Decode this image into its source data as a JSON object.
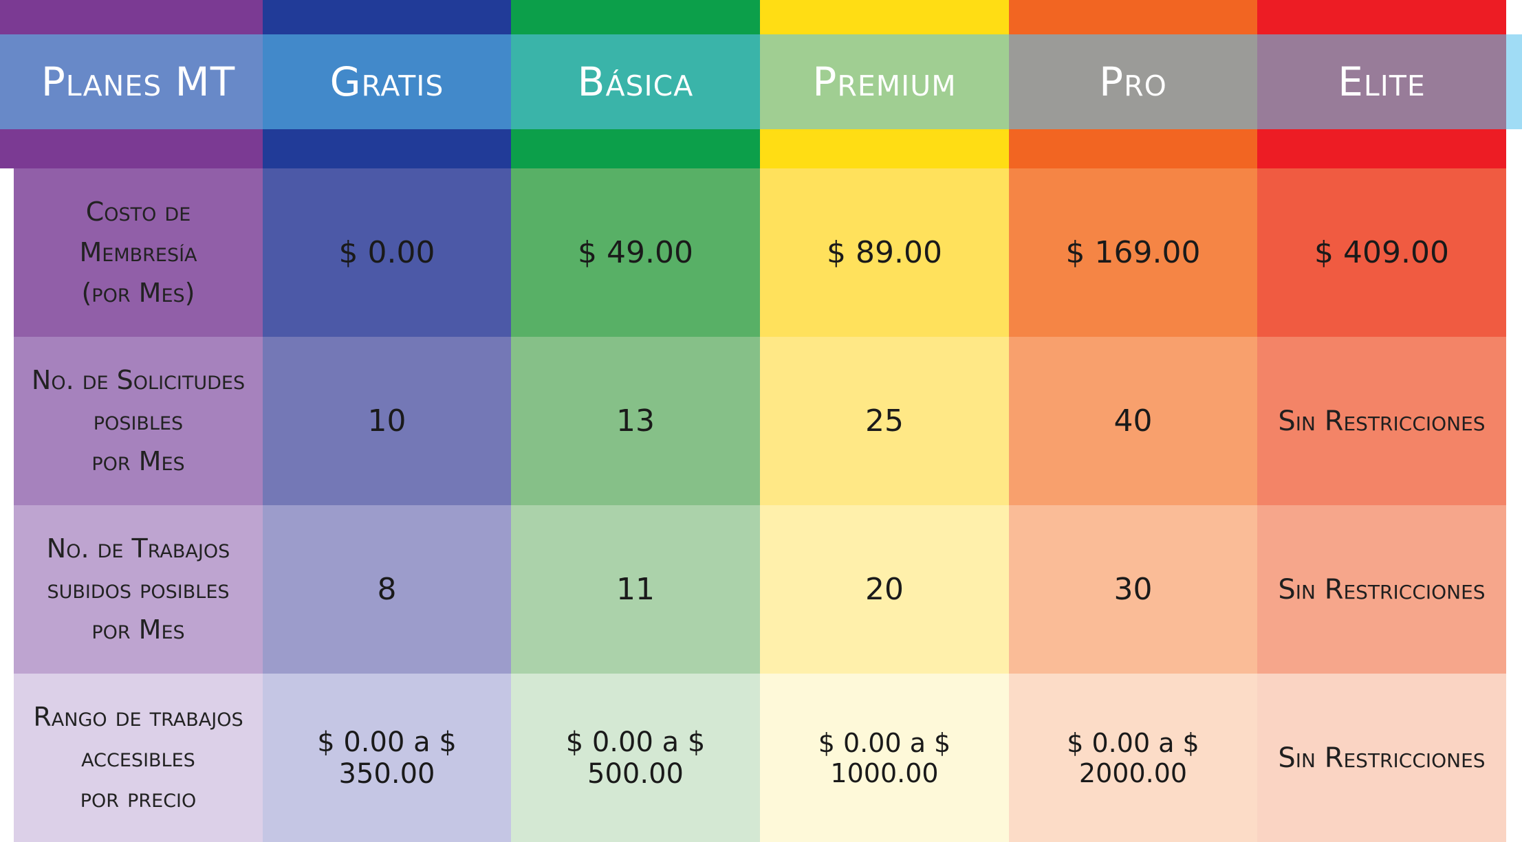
{
  "header": {
    "label_col": "Planes MT",
    "plans": [
      "Gratis",
      "Básica",
      "Premium",
      "Pro",
      "Elite"
    ]
  },
  "rows": [
    {
      "label": [
        "Costo de",
        "Membresía",
        "(por Mes)"
      ],
      "values": [
        "$ 0.00",
        "$ 49.00",
        "$ 89.00",
        "$ 169.00",
        "$ 409.00"
      ]
    },
    {
      "label": [
        "No. de Solicitudes",
        "posibles",
        "por Mes"
      ],
      "values": [
        "10",
        "13",
        "25",
        "40",
        "Sin Restricciones"
      ]
    },
    {
      "label": [
        "No. de Trabajos",
        "subidos posibles",
        "por Mes"
      ],
      "values": [
        "8",
        "11",
        "20",
        "30",
        "Sin Restricciones"
      ]
    },
    {
      "label": [
        "Rango de trabajos",
        "accesibles",
        "por precio"
      ],
      "values": [
        "$ 0.00 a $ 350.00",
        "$ 0.00 a $ 500.00",
        "$ 0.00 a $ 1000.00",
        "$ 0.00 a $ 2000.00",
        "Sin Restricciones"
      ]
    }
  ],
  "colors": {
    "label_col": [
      "#7b3a93",
      "#915fa8",
      "#a682bd",
      "#bea4d0",
      "#dcd0e8"
    ],
    "gratis": [
      "#213b98",
      "#4c59a7",
      "#7478b6",
      "#9c9ccb",
      "#c5c6e4"
    ],
    "basica": [
      "#0c9f4a",
      "#58b066",
      "#86c088",
      "#abd2aa",
      "#d4e8d3"
    ],
    "premium": [
      "#ffdd14",
      "#ffe15c",
      "#ffe886",
      "#fff0ab",
      "#fef9d9"
    ],
    "pro": [
      "#f26522",
      "#f58545",
      "#f8a06d",
      "#fabc97",
      "#fcdcc7"
    ],
    "elite": [
      "#ed1c24",
      "#f05b41",
      "#f38467",
      "#f6a68b",
      "#fad4c3"
    ],
    "header_band": "#5bc3ee"
  }
}
